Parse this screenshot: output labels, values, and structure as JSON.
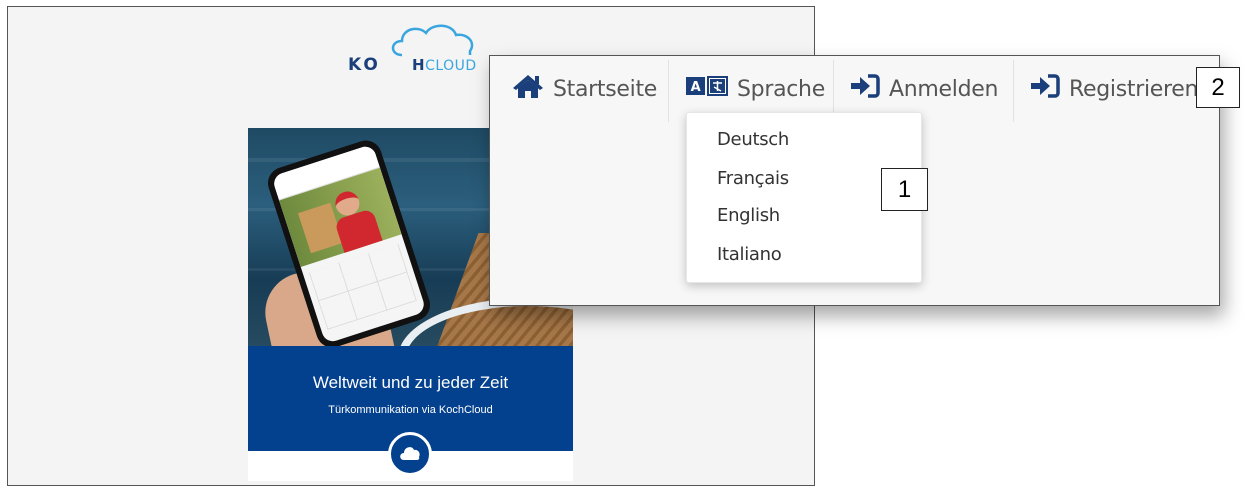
{
  "logo": {
    "ko": "KO",
    "h": "H",
    "cloud": "CLOUD"
  },
  "promo": {
    "headline": "Weltweit und zu jeder Zeit",
    "subline": "Türkommunikation via KochCloud"
  },
  "nav": {
    "items": [
      {
        "label": "Startseite",
        "icon": "home-icon"
      },
      {
        "label": "Sprache",
        "icon": "translate-icon"
      },
      {
        "label": "Anmelden",
        "icon": "sign-in-icon"
      },
      {
        "label": "Registrieren",
        "icon": "sign-in-icon"
      }
    ]
  },
  "language_menu": {
    "options": [
      "Deutsch",
      "Français",
      "English",
      "Italiano"
    ]
  },
  "callouts": {
    "one": "1",
    "two": "2"
  },
  "colors": {
    "brand_blue": "#03408e",
    "nav_icon": "#1b3f7a",
    "cloud_blue": "#3aa6df"
  }
}
